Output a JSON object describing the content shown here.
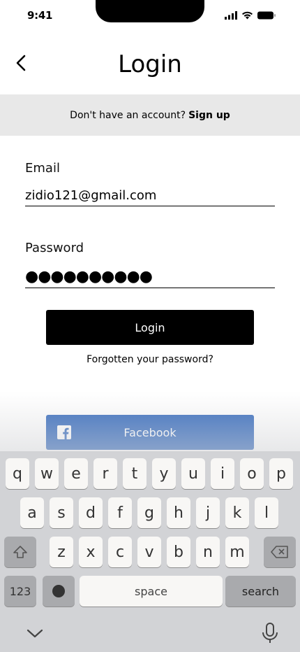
{
  "status_bar": {
    "time": "9:41"
  },
  "header": {
    "title": "Login"
  },
  "signup": {
    "prompt": "Don't have an account?",
    "link": "Sign up"
  },
  "form": {
    "email_label": "Email",
    "email_value": "zidio121@gmail.com",
    "password_label": "Password",
    "password_value": "●●●●●●●●●●"
  },
  "actions": {
    "login_label": "Login",
    "forgot_label": "Forgotten your password?",
    "facebook_label": "Facebook"
  },
  "keyboard": {
    "row1": [
      "q",
      "w",
      "e",
      "r",
      "t",
      "y",
      "u",
      "i",
      "o",
      "p"
    ],
    "row2": [
      "a",
      "s",
      "d",
      "f",
      "g",
      "h",
      "j",
      "k",
      "l"
    ],
    "row3": [
      "z",
      "x",
      "c",
      "v",
      "b",
      "n",
      "m"
    ],
    "numbers_label": "123",
    "space_label": "space",
    "search_label": "search"
  },
  "colors": {
    "facebook": "#3b6fbf",
    "login_button": "#000000",
    "signup_bar": "#e8e8e8",
    "keyboard_bg": "#d2d3d6"
  }
}
